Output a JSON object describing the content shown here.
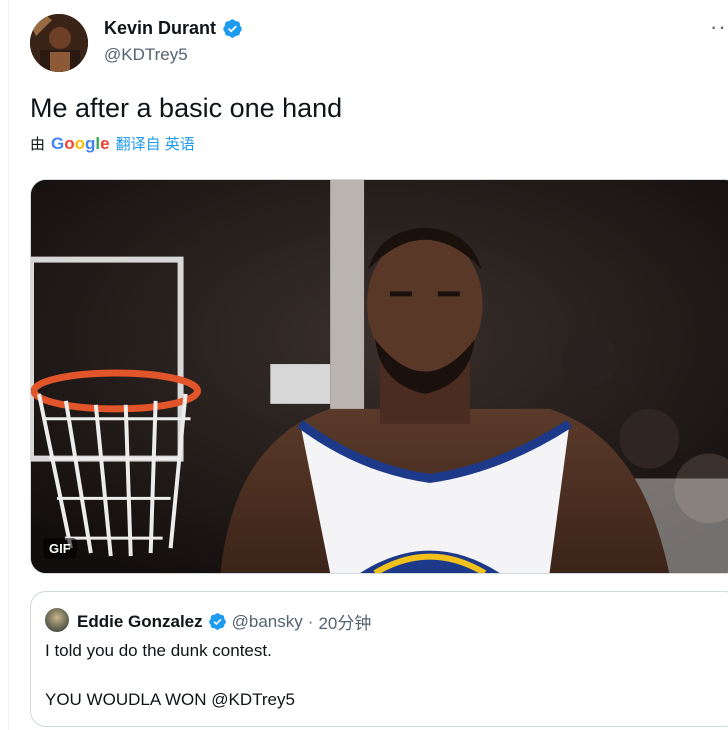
{
  "author": {
    "display_name": "Kevin Durant",
    "handle": "@KDTrey5",
    "avatar_icon": "profile-avatar",
    "verified_icon": "verified-badge-icon"
  },
  "more_label": "···",
  "tweet": {
    "text": "Me after a basic one hand"
  },
  "translation": {
    "prefix": "由",
    "provider": "Google",
    "link_text": "翻译自 英语"
  },
  "media": {
    "badge": "GIF"
  },
  "quote": {
    "display_name": "Eddie Gonzalez",
    "handle": "@bansky",
    "separator": "·",
    "time": "20分钟",
    "line1": "I told you do the dunk contest.",
    "line2": "YOU WOUDLA WON @KDTrey5"
  },
  "colors": {
    "accent": "#1d9bf0",
    "text": "#0f1419",
    "muted": "#536471",
    "border": "#cfd9de"
  }
}
